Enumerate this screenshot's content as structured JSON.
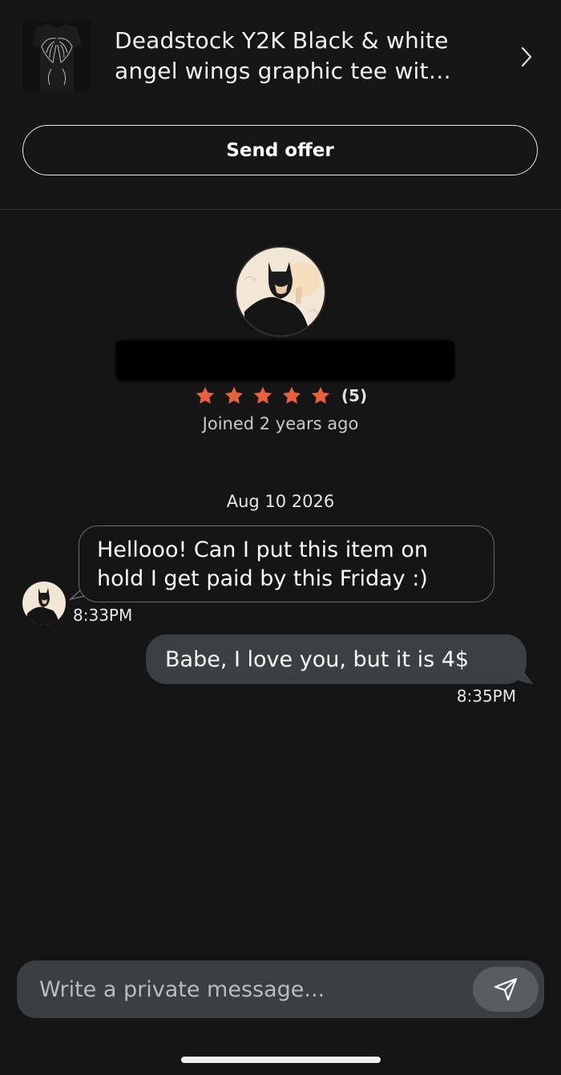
{
  "listing": {
    "title": "Deadstock Y2K Black & white angel wings graphic tee wit…",
    "thumbnail_icon": "tee-thumbnail",
    "chevron_icon": "chevron-right-icon"
  },
  "actions": {
    "send_offer_label": "Send offer"
  },
  "profile": {
    "avatar_icon": "user-avatar",
    "rating_stars": 5,
    "rating_count": "(5)",
    "joined": "Joined 2 years ago",
    "star_color": "#e8603c"
  },
  "conversation": {
    "date": "Aug 10 2026",
    "messages": [
      {
        "direction": "incoming",
        "text": "Hellooo! Can I put this item on hold I get paid by this Friday :)",
        "time": "8:33PM"
      },
      {
        "direction": "outgoing",
        "text": "Babe, I love you, but it is 4$",
        "time": "8:35PM"
      }
    ]
  },
  "composer": {
    "placeholder": "Write a private message...",
    "send_icon": "send-icon"
  },
  "colors": {
    "background": "#151515",
    "outgoing_bubble": "#3b4042",
    "composer": "#3a3f41"
  }
}
